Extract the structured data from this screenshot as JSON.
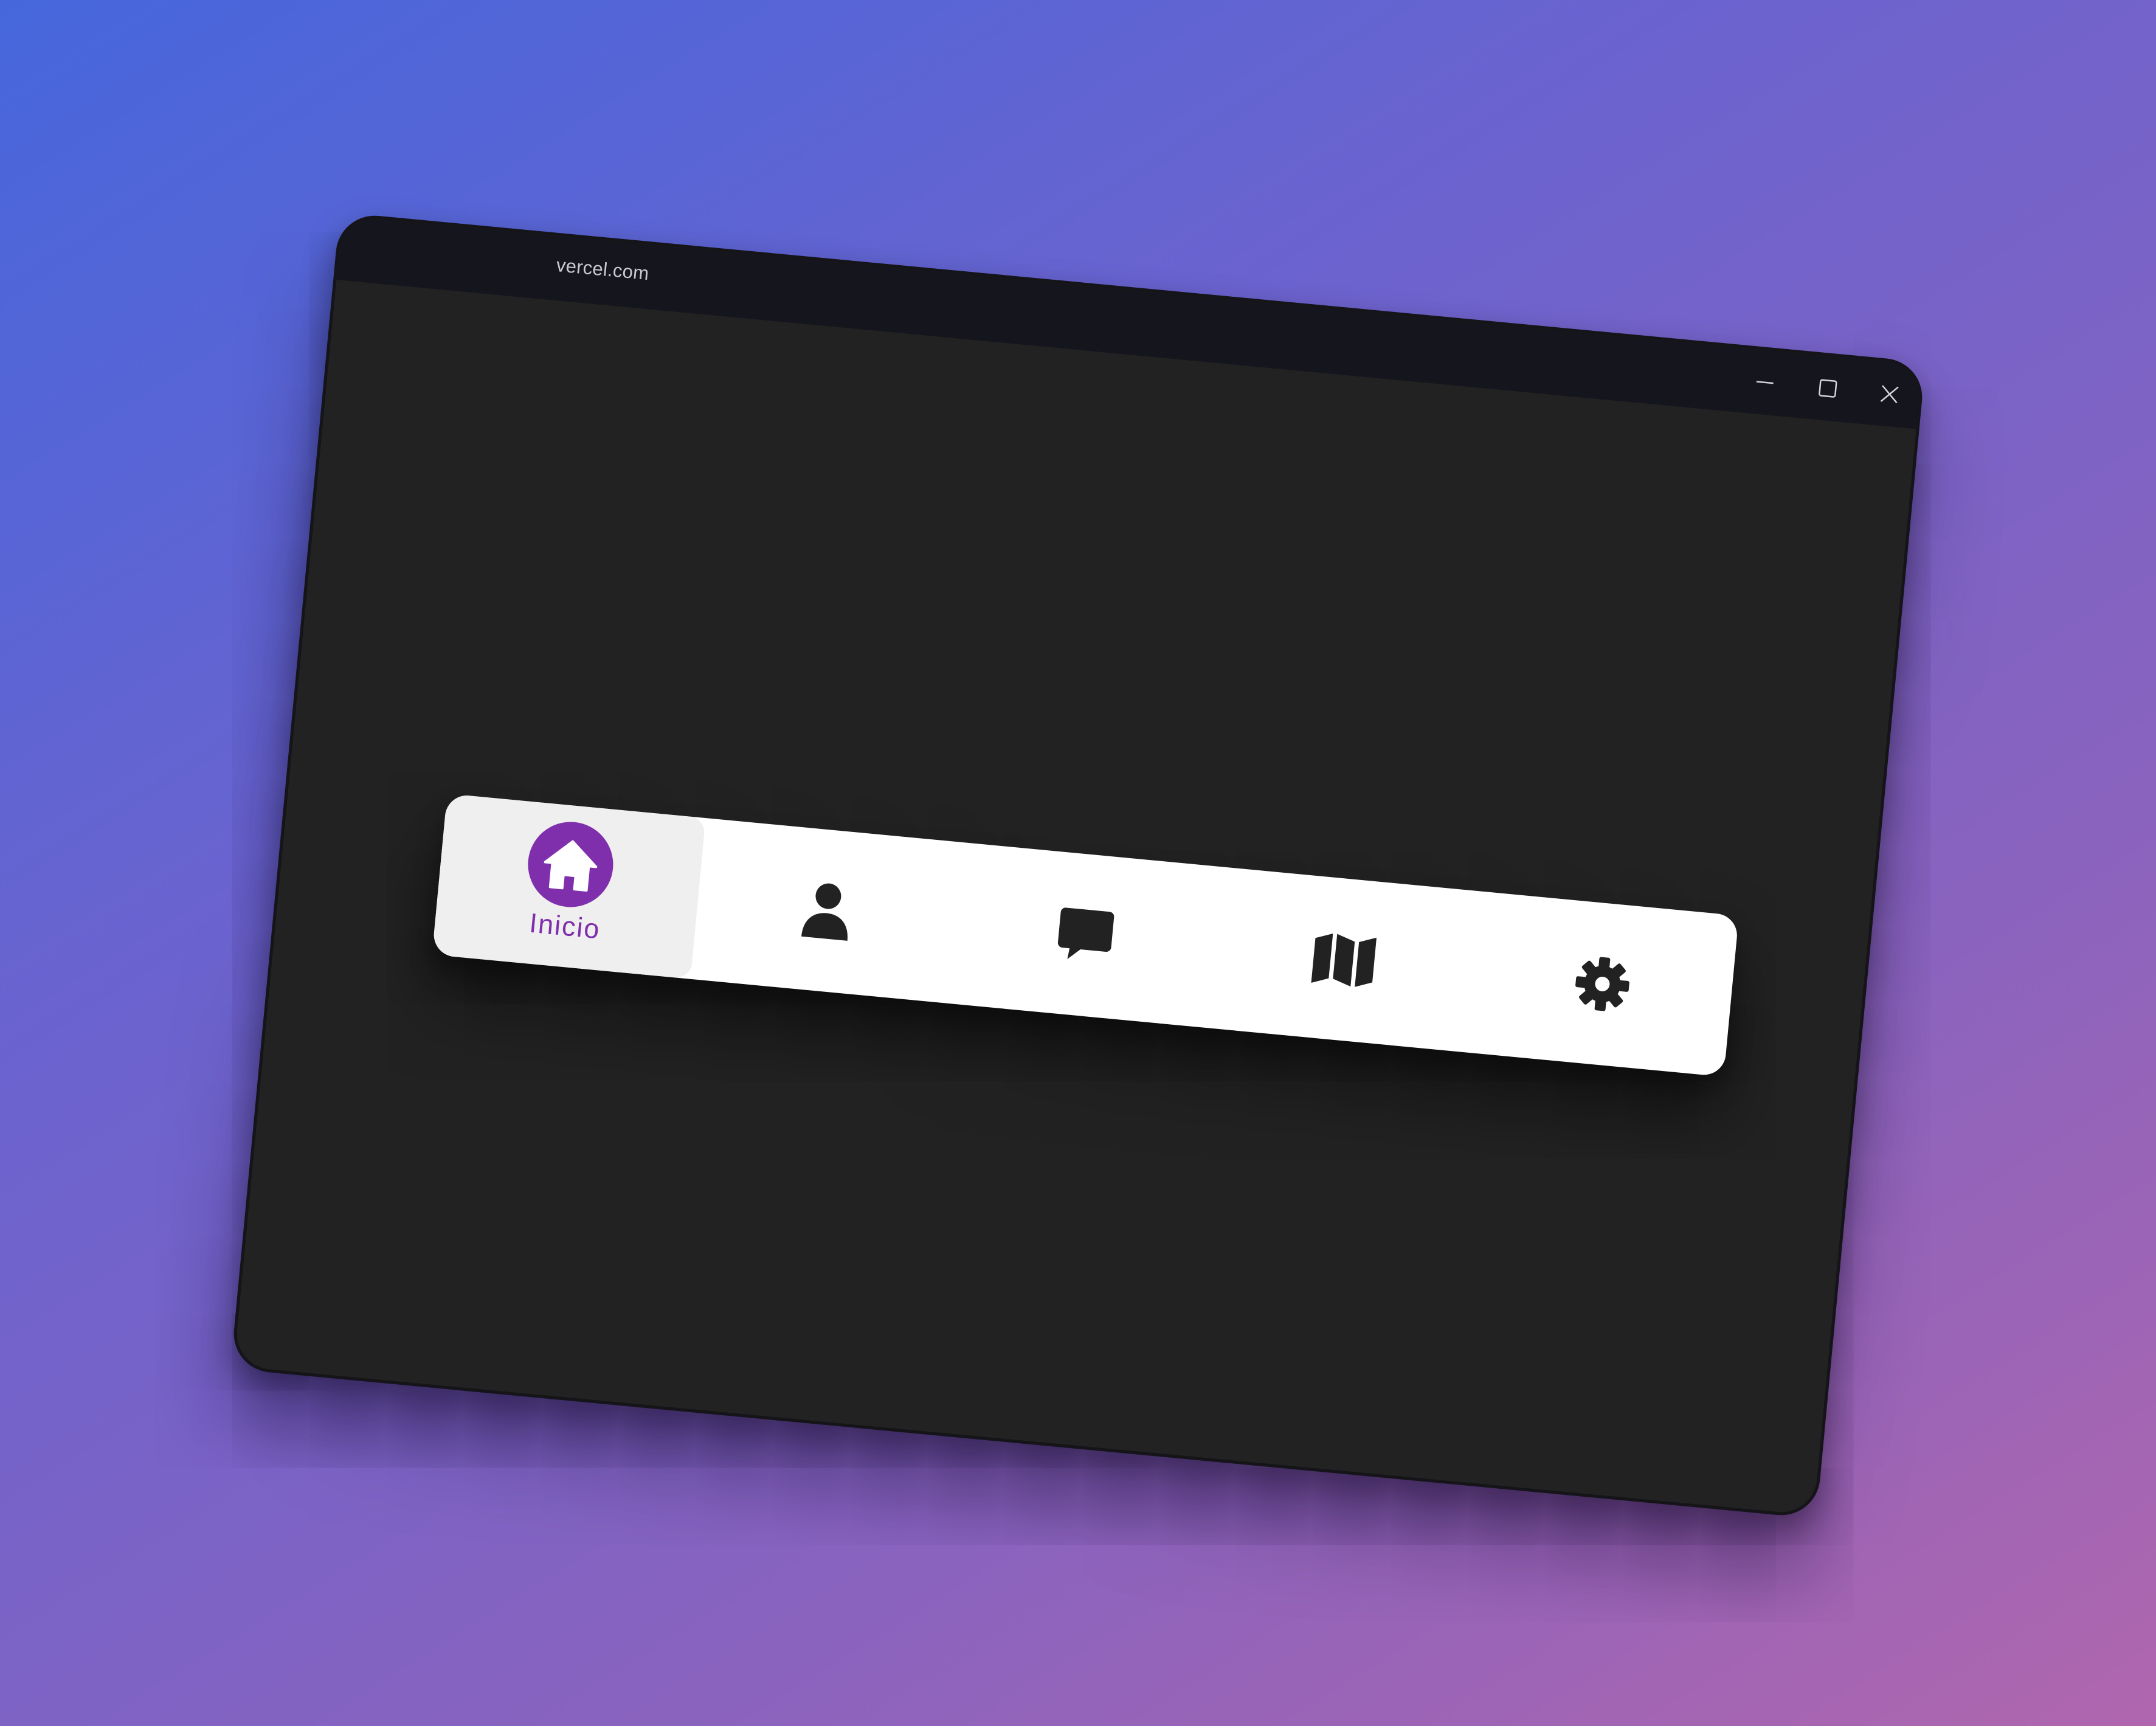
{
  "browser": {
    "url": "vercel.com"
  },
  "window_controls": {
    "minimize_icon": "minimize-icon",
    "maximize_icon": "maximize-icon",
    "close_icon": "close-icon"
  },
  "nav": {
    "items": [
      {
        "id": "home",
        "label": "Inicio",
        "icon": "home-icon",
        "active": true
      },
      {
        "id": "profile",
        "label": "",
        "icon": "user-icon",
        "active": false
      },
      {
        "id": "messages",
        "label": "",
        "icon": "chat-icon",
        "active": false
      },
      {
        "id": "map",
        "label": "",
        "icon": "map-icon",
        "active": false
      },
      {
        "id": "settings",
        "label": "",
        "icon": "gear-icon",
        "active": false
      }
    ]
  },
  "colors": {
    "accent": "#7f2fac",
    "window_bg": "#222222",
    "titlebar_bg": "#15151d",
    "nav_bg": "#ffffff",
    "active_item_bg": "#efefef",
    "icon": "#222222"
  }
}
